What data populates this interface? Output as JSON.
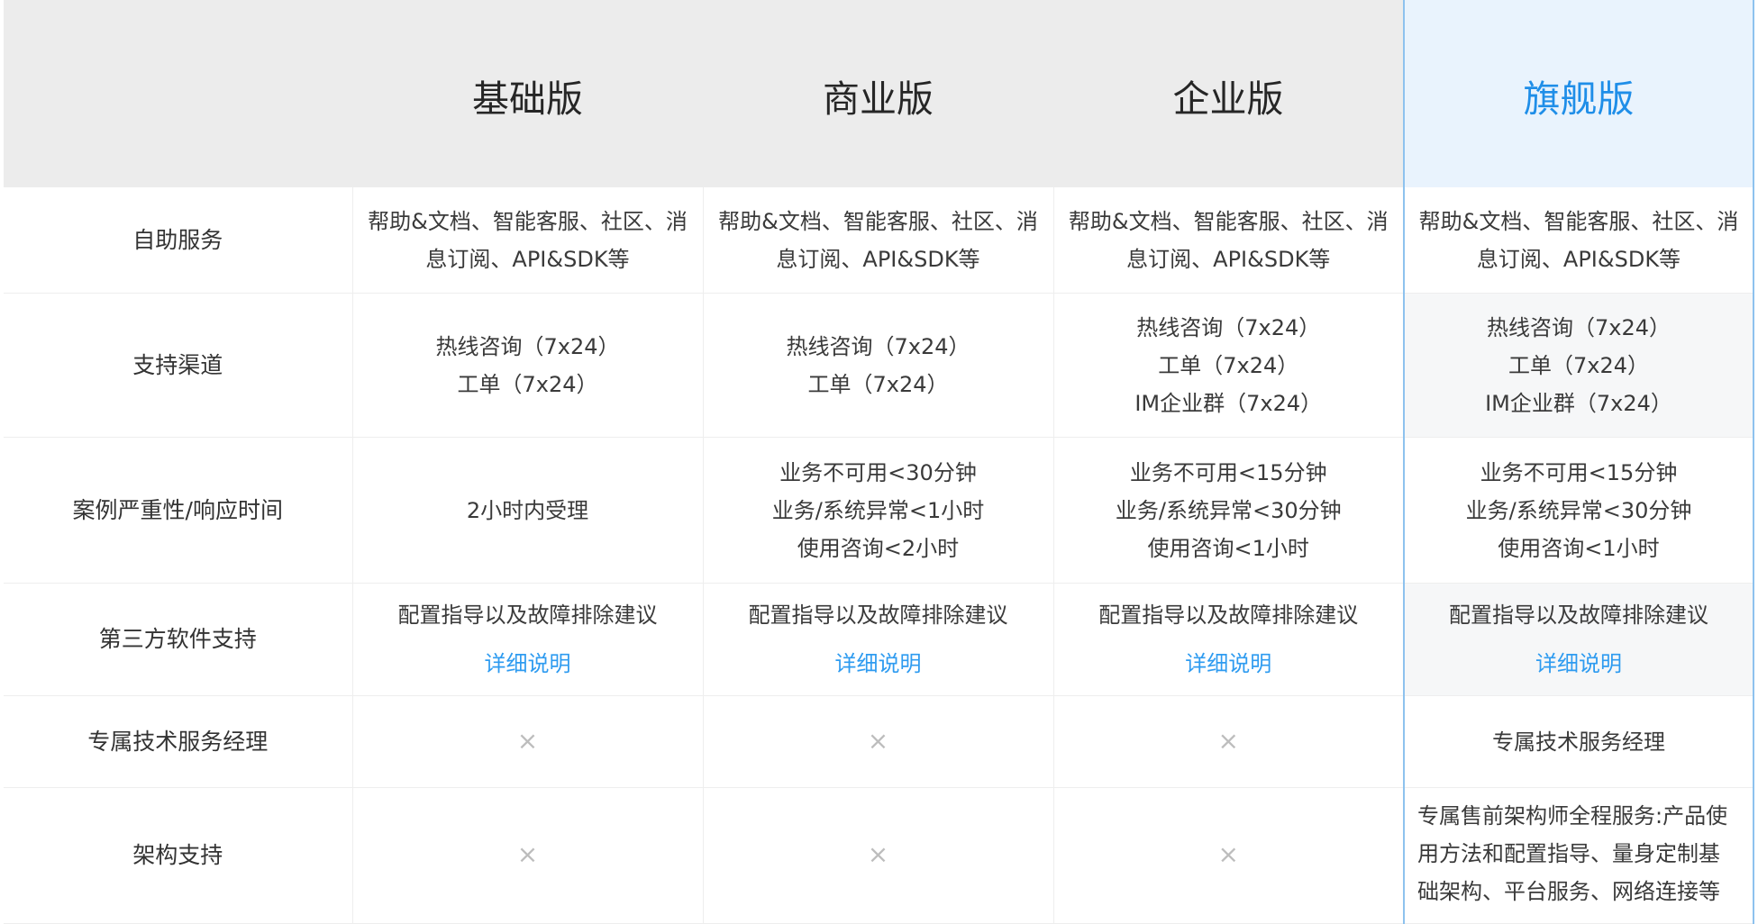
{
  "header": {
    "plans": [
      "基础版",
      "商业版",
      "企业版",
      "旗舰版"
    ]
  },
  "rows": {
    "self_service": {
      "label": "自助服务",
      "values": [
        {
          "line1": "帮助&文档、智能客服、社区、消",
          "line2": "息订阅、API&SDK等"
        },
        {
          "line1": "帮助&文档、智能客服、社区、消",
          "line2": "息订阅、API&SDK等"
        },
        {
          "line1": "帮助&文档、智能客服、社区、消",
          "line2": "息订阅、API&SDK等"
        },
        {
          "line1": "帮助&文档、智能客服、社区、消",
          "line2": "息订阅、API&SDK等"
        }
      ]
    },
    "channels": {
      "label": "支持渠道",
      "values": [
        {
          "lines": [
            "热线咨询（7x24）",
            "工单（7x24）"
          ]
        },
        {
          "lines": [
            "热线咨询（7x24）",
            "工单（7x24）"
          ]
        },
        {
          "lines": [
            "热线咨询（7x24）",
            "工单（7x24）",
            "IM企业群（7x24）"
          ]
        },
        {
          "lines": [
            "热线咨询（7x24）",
            "工单（7x24）",
            "IM企业群（7x24）"
          ]
        }
      ]
    },
    "severity": {
      "label": "案例严重性/响应时间",
      "values": [
        {
          "lines": [
            "2小时内受理"
          ]
        },
        {
          "lines": [
            "业务不可用<30分钟",
            "业务/系统异常<1小时",
            "使用咨询<2小时"
          ]
        },
        {
          "lines": [
            "业务不可用<15分钟",
            "业务/系统异常<30分钟",
            "使用咨询<1小时"
          ]
        },
        {
          "lines": [
            "业务不可用<15分钟",
            "业务/系统异常<30分钟",
            "使用咨询<1小时"
          ]
        }
      ]
    },
    "third_party": {
      "label": "第三方软件支持",
      "text": "配置指导以及故障排除建议",
      "link": "详细说明"
    },
    "tam": {
      "label": "专属技术服务经理",
      "cross": "×",
      "flagship": "专属技术服务经理"
    },
    "architecture": {
      "label": "架构支持",
      "cross": "×",
      "flagship_lines": [
        "专属售前架构师全程服务:产品使",
        "用方法和配置指导、量身定制基",
        "础架构、平台服务、网络连接等"
      ]
    }
  },
  "colors": {
    "header_bg": "#ececec",
    "flagship_header_bg": "#e9f3fd",
    "flagship_accent": "#1f8ee8",
    "link": "#2e9bf0",
    "cross": "#bdbdbd"
  }
}
